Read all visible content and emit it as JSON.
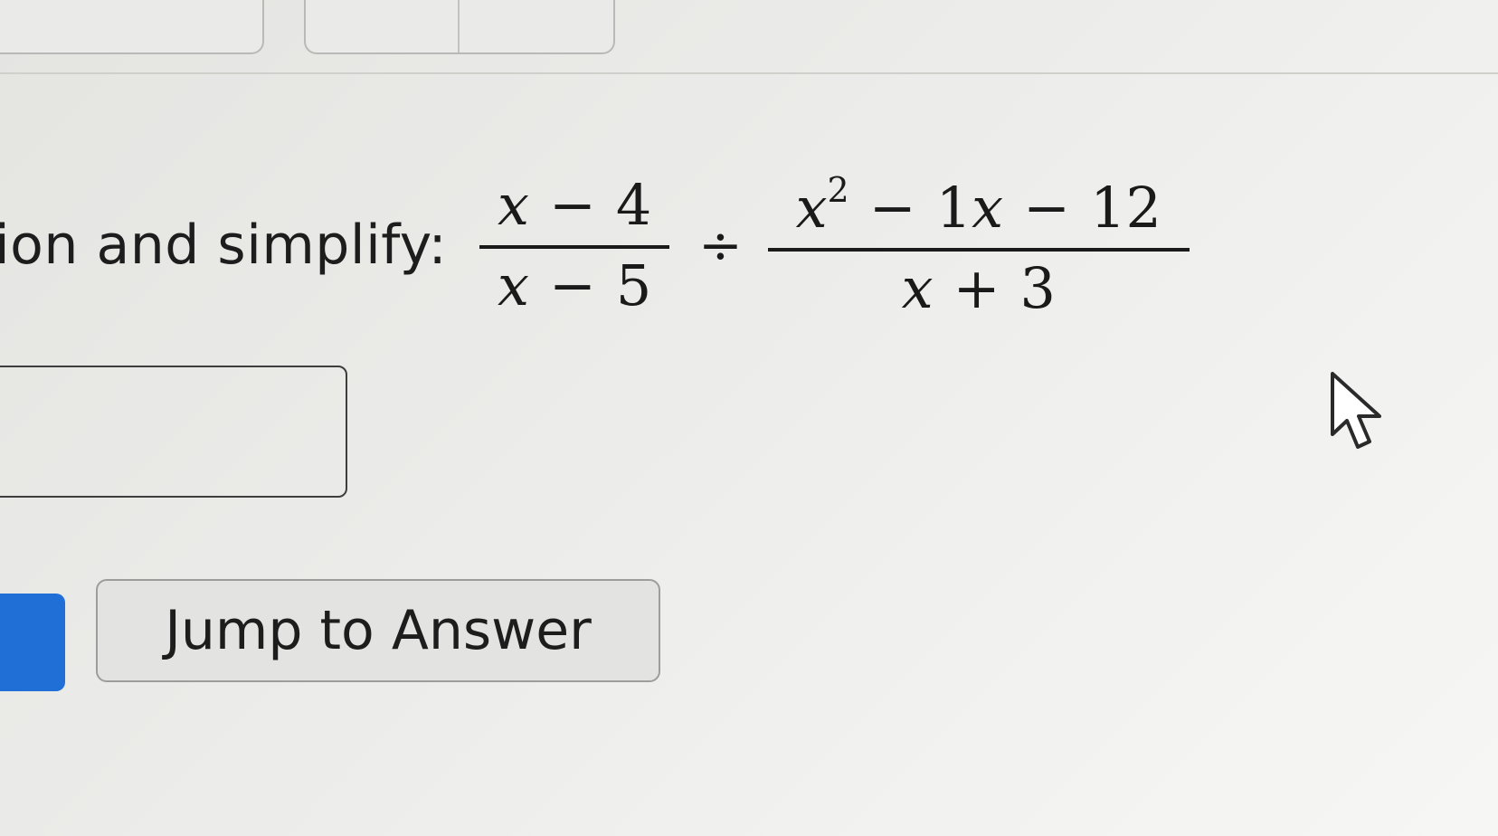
{
  "question": {
    "prompt": "ion and simplify:",
    "fraction1": {
      "numerator": {
        "var": "x",
        "op": "−",
        "const": "4"
      },
      "denominator": {
        "var": "x",
        "op": "−",
        "const": "5"
      }
    },
    "divide_symbol": "÷",
    "fraction2": {
      "numerator": {
        "var1": "x",
        "exponent": "2",
        "op1": "−",
        "coef": "1",
        "var2": "x",
        "op2": "−",
        "const": "12"
      },
      "denominator": {
        "var": "x",
        "op": "+",
        "const": "3"
      }
    }
  },
  "answer_input": {
    "value": ""
  },
  "buttons": {
    "jump_to_answer": "Jump to Answer"
  },
  "colors": {
    "primary_button": "#1f6fd6"
  },
  "icons": {
    "cursor": "mouse-pointer-icon"
  }
}
